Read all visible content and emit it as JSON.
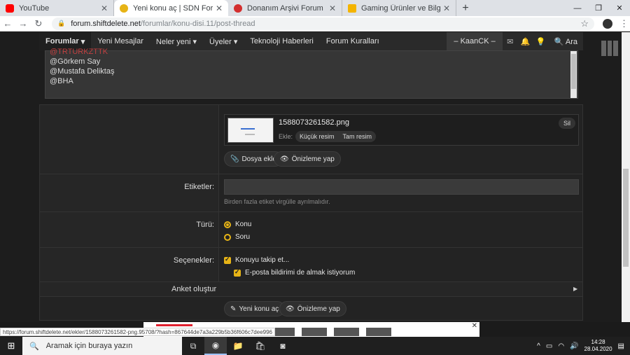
{
  "browser": {
    "tabs": [
      {
        "label": "YouTube",
        "color": "#ff0000",
        "active": false
      },
      {
        "label": "Yeni konu aç | SDN Forum",
        "color": "#e7b416",
        "active": true
      },
      {
        "label": "Donanım Arşivi Forum",
        "color": "#d32f2f",
        "active": false
      },
      {
        "label": "Gaming Ürünler ve Bilgisayar Bile",
        "color": "#f4b400",
        "active": false
      }
    ],
    "new_tab": "+",
    "url_host": "forum.shiftdelete.net",
    "url_path": "/forumlar/konu-disi.11/post-thread"
  },
  "navbar": {
    "items": [
      "Forumlar",
      "Yeni Mesajlar",
      "Neler yeni",
      "Üyeler",
      "Teknoloji Haberleri",
      "Forum Kuralları"
    ],
    "user": "– KaanCK –",
    "search": "Ara"
  },
  "editor": {
    "lines": [
      "@TRTURKZTTK",
      "@Görkem Say",
      "@Mustafa Deliktaş",
      "@BHA"
    ]
  },
  "attachment": {
    "filename": "1588073261582.png",
    "insert_label": "Ekle:",
    "small_image": "Küçük resim",
    "full_image": "Tam resim",
    "delete": "Sil"
  },
  "buttons": {
    "attach_file": "Dosya ekle",
    "preview": "Önizleme yap",
    "submit": "Yeni konu aç",
    "preview2": "Önizleme yap"
  },
  "tags": {
    "label": "Etiketler:",
    "hint": "Birden fazla etiket virgülle ayrılmalıdır."
  },
  "type": {
    "label": "Türü:",
    "options": [
      {
        "label": "Konu",
        "selected": true
      },
      {
        "label": "Soru",
        "selected": false
      }
    ]
  },
  "options": {
    "label": "Seçenekler:",
    "watch": "Konuyu takip et...",
    "email": "E-posta bildirimi de almak istiyorum"
  },
  "poll": {
    "label": "Anket oluştur"
  },
  "status_url": "https://forum.shiftdelete.net/ekler/1588073261582-png.95708/?hash=867644de7a3a229b5b36f606c7dee996",
  "taskbar": {
    "search_placeholder": "Aramak için buraya yazın",
    "time": "14:28",
    "date": "28.04.2020"
  }
}
